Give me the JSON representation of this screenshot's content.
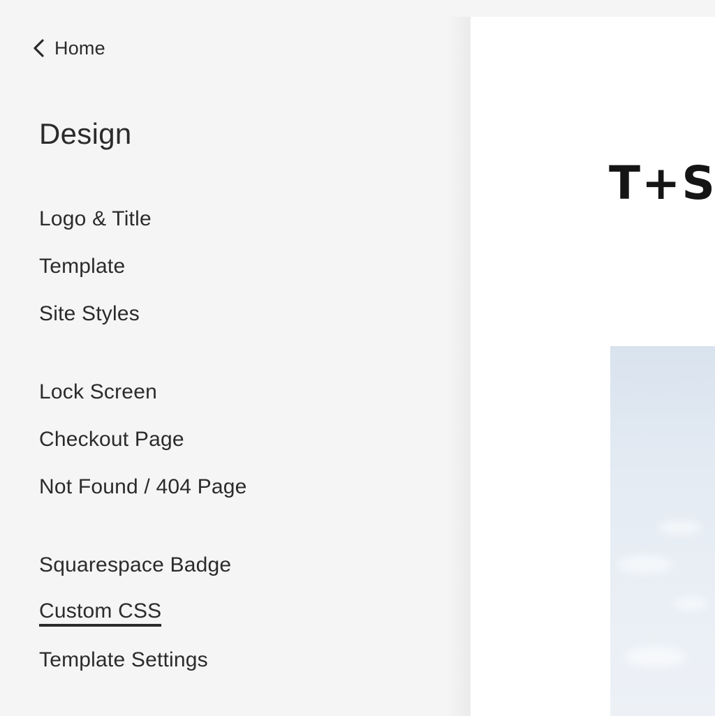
{
  "nav": {
    "back_label": "Home",
    "back_icon": "chevron-left-icon"
  },
  "panel": {
    "title": "Design",
    "groups": [
      [
        "Logo & Title",
        "Template",
        "Site Styles"
      ],
      [
        "Lock Screen",
        "Checkout Page",
        "Not Found / 404 Page"
      ],
      [
        "Squarespace Badge",
        "Custom CSS",
        "Template Settings"
      ]
    ],
    "active_item": "Custom CSS"
  },
  "preview": {
    "site_logo": "T+S",
    "hero_image": "sky-photo"
  },
  "colors": {
    "sidebar_bg": "#f5f5f5",
    "text": "#2b2b2b",
    "preview_bg": "#ffffff",
    "logo": "#151515",
    "sky": "#dde6f0"
  }
}
